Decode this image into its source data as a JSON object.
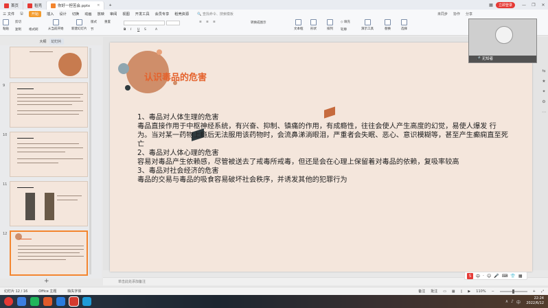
{
  "titlebar": {
    "tabs": [
      {
        "label": "首页",
        "color": "#e53935"
      },
      {
        "label": "稻壳",
        "color": "#e53935"
      },
      {
        "label": "你好一担苦会.pptx",
        "color": "#f3852e"
      }
    ],
    "login_label": "立即登录",
    "add_tab": "+"
  },
  "menubar": {
    "file_label": "三 文件",
    "items": [
      "开始",
      "插入",
      "设计",
      "切换",
      "动画",
      "放映",
      "审阅",
      "视图",
      "开发工具",
      "会员专享",
      "稻壳资源"
    ],
    "search_placeholder": "查找命令、搜索模板",
    "right_items": [
      "未同步",
      "协作",
      "分享"
    ]
  },
  "ribbon": {
    "buttons": [
      "粘贴",
      "剪切",
      "复制",
      "格式刷",
      "从当前开始",
      "新建幻灯片",
      "版式",
      "节",
      "重置",
      "文本框",
      "形状",
      "排列",
      "轮廓",
      "演示工具",
      "替换",
      "选择"
    ],
    "small_labels": [
      "转换成图示",
      "A 文字颜色",
      "◇ 填充"
    ]
  },
  "leftpanel": {
    "tabs": [
      "大纲",
      "幻灯片"
    ],
    "slide_numbers": [
      "9",
      "10",
      "11",
      "12"
    ],
    "add_label": "+"
  },
  "slide": {
    "title": "认识毒品的危害",
    "paragraphs": [
      "1、毒品对人体生理的危害",
      "毒品直接作用于中枢神经系统，有兴奋、抑制、镇痛的作用，有成瘾性，往往会使人产生高度的幻觉，易使人爆发 行为。当对某一药物上瘾后无法服用该药物时，会流鼻涕淌眼泪，严重者会失眠、恶心、意识模糊等，甚至产生癫痫直至死亡",
      "2、毒品对人体心理的危害",
      "容易对毒品产生依赖感，尽管被送去了戒毒所戒毒，但还是会在心理上保留着对毒品的依赖，复吸率较高",
      "3、毒品对社会经济的危害",
      "毒品的交易与毒品的吸食容易破坏社会秩序，并诱发其他的犯罪行为"
    ],
    "colors": {
      "accent": "#e4622c",
      "circle_large": "#cf8e6a",
      "circle_small_blue": "#8fa6b0",
      "dark": "#2f3b3f"
    }
  },
  "notes": {
    "placeholder": "单击此处添加备注"
  },
  "ime": {
    "label": "中",
    "icons": [
      "·",
      "☺",
      "🎤",
      "⌨",
      "👕",
      "▦"
    ]
  },
  "statusbar": {
    "slide_info": "幻灯片 12 / 16",
    "theme": "Office 主题",
    "font_missing": "缺失字体",
    "notes_btn": "备注",
    "comment_btn": "批注",
    "zoom": "110%"
  },
  "cam": {
    "name": "无知者"
  },
  "taskbar": {
    "time": "22:24",
    "date": "2022/6/12",
    "tray": [
      "∧",
      "♪",
      "中"
    ]
  }
}
